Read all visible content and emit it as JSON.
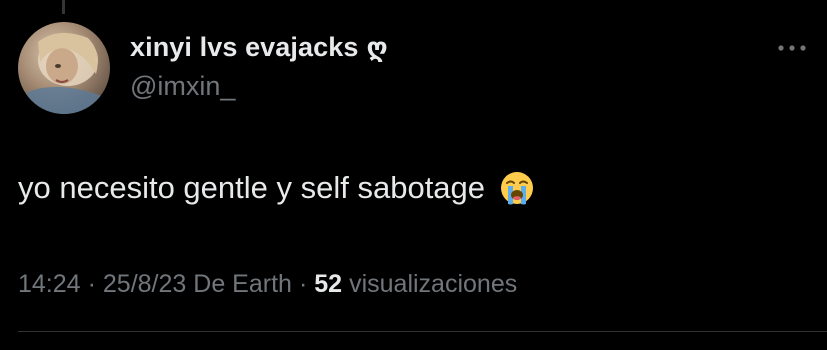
{
  "tweet": {
    "author": {
      "display_name": "xinyi lvs evajacks",
      "name_glyph": "ღ",
      "handle": "@imxin_",
      "avatar_icon": "profile-photo"
    },
    "text": "yo necesito gentle y self sabotage",
    "emoji_icon": "loudly-crying-face",
    "meta": {
      "time": "14:24",
      "separator": "·",
      "date": "25/8/23",
      "source": "De Earth",
      "views_count": "52",
      "views_label": "visualizaciones"
    },
    "more_icon": "more-options"
  },
  "colors": {
    "background": "#000000",
    "primary_text": "#e7e9ea",
    "secondary_text": "#71767b",
    "divider": "#2f3336"
  }
}
